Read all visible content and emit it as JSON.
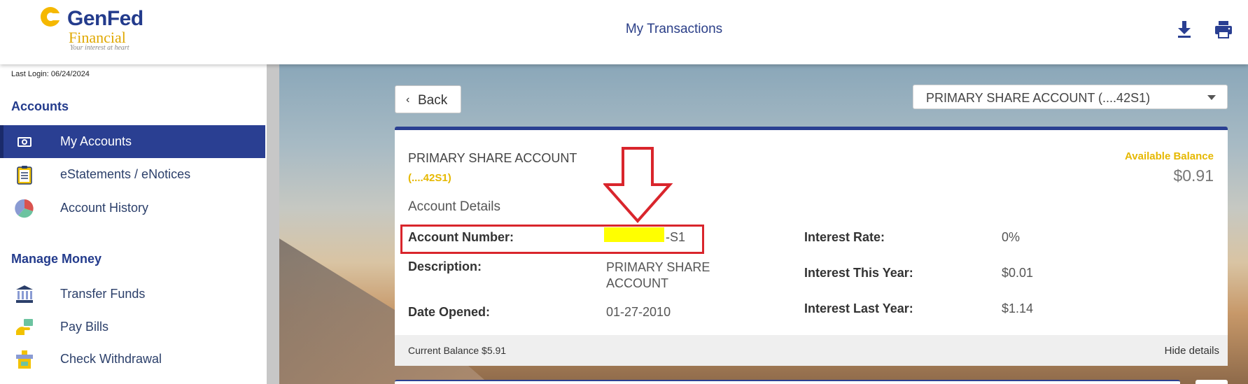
{
  "header": {
    "logo_text_primary": "GenFed",
    "logo_text_secondary": "Financial",
    "logo_tagline": "Your interest at heart",
    "title": "My Transactions",
    "download_icon": "download-icon",
    "print_icon": "print-icon"
  },
  "sidebar": {
    "last_login": "Last Login: 06/24/2024",
    "sections": [
      {
        "title": "Accounts",
        "items": [
          {
            "label": "My Accounts",
            "icon": "money-icon",
            "active": true
          },
          {
            "label": "eStatements / eNotices",
            "icon": "clipboard-icon",
            "active": false
          },
          {
            "label": "Account History",
            "icon": "pie-chart-icon",
            "active": false
          }
        ]
      },
      {
        "title": "Manage Money",
        "items": [
          {
            "label": "Transfer Funds",
            "icon": "bank-icon",
            "active": false
          },
          {
            "label": "Pay Bills",
            "icon": "pay-bills-icon",
            "active": false
          },
          {
            "label": "Check Withdrawal",
            "icon": "check-withdrawal-icon",
            "active": false
          }
        ]
      }
    ]
  },
  "main": {
    "back_label": "Back",
    "account_select": "PRIMARY SHARE ACCOUNT (....42S1)",
    "card": {
      "account_name": "PRIMARY SHARE ACCOUNT",
      "account_mask": "(....42S1)",
      "available_label": "Available Balance",
      "available_value": "$0.91",
      "details_heading": "Account Details",
      "details_left": [
        {
          "label": "Account Number:",
          "value": "-S1"
        },
        {
          "label": "Description:",
          "value": "PRIMARY SHARE ACCOUNT"
        },
        {
          "label": "Date Opened:",
          "value": "01-27-2010"
        }
      ],
      "details_right": [
        {
          "label": "Interest Rate:",
          "value": "0%"
        },
        {
          "label": "Interest This Year:",
          "value": "$0.01"
        },
        {
          "label": "Interest Last Year:",
          "value": "$1.14"
        }
      ],
      "current_balance": "Current Balance $5.91",
      "hide_details": "Hide details"
    }
  },
  "colors": {
    "brand_blue": "#2a3f92",
    "brand_gold": "#e6b800",
    "annotation_red": "#d9252c",
    "redaction_yellow": "#ffff00"
  }
}
